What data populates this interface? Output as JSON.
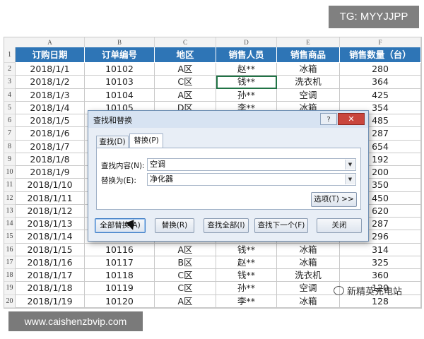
{
  "badges": {
    "tg": "TG: MYYJJPP",
    "url": "www.caishenzbvip.com",
    "watermark": "新精英充电站"
  },
  "spreadsheet": {
    "column_letters": [
      "A",
      "B",
      "C",
      "D",
      "E",
      "F"
    ],
    "headers": [
      "订购日期",
      "订单编号",
      "地区",
      "销售人员",
      "销售商品",
      "销售数量（台）"
    ],
    "row_numbers": [
      "1",
      "2",
      "3",
      "4",
      "5",
      "6",
      "7",
      "8",
      "9",
      "10",
      "11",
      "12",
      "13",
      "14",
      "15",
      "16",
      "17",
      "18",
      "19",
      "20"
    ],
    "rows": [
      [
        "2018/1/1",
        "10102",
        "A区",
        "赵**",
        "冰箱",
        "280"
      ],
      [
        "2018/1/2",
        "10103",
        "C区",
        "钱**",
        "洗衣机",
        "364"
      ],
      [
        "2018/1/3",
        "10104",
        "A区",
        "孙**",
        "空调",
        "425"
      ],
      [
        "2018/1/4",
        "10105",
        "D区",
        "李**",
        "冰箱",
        "354"
      ],
      [
        "2018/1/5",
        "",
        "",
        "",
        "",
        "485"
      ],
      [
        "2018/1/6",
        "",
        "",
        "",
        "",
        "287"
      ],
      [
        "2018/1/7",
        "",
        "",
        "",
        "",
        "654"
      ],
      [
        "2018/1/8",
        "",
        "",
        "",
        "",
        "192"
      ],
      [
        "2018/1/9",
        "",
        "",
        "",
        "",
        "200"
      ],
      [
        "2018/1/10",
        "",
        "",
        "",
        "",
        "350"
      ],
      [
        "2018/1/11",
        "",
        "",
        "",
        "",
        "450"
      ],
      [
        "2018/1/12",
        "",
        "",
        "",
        "",
        "620"
      ],
      [
        "2018/1/13",
        "",
        "",
        "",
        "",
        "287"
      ],
      [
        "2018/1/14",
        "",
        "",
        "",
        "",
        "296"
      ],
      [
        "2018/1/15",
        "10116",
        "A区",
        "钱**",
        "冰箱",
        "314"
      ],
      [
        "2018/1/16",
        "10117",
        "B区",
        "赵**",
        "冰箱",
        "325"
      ],
      [
        "2018/1/17",
        "10118",
        "C区",
        "钱**",
        "洗衣机",
        "360"
      ],
      [
        "2018/1/18",
        "10119",
        "C区",
        "孙**",
        "空调",
        "120"
      ],
      [
        "2018/1/19",
        "10120",
        "A区",
        "李**",
        "冰箱",
        "128"
      ]
    ]
  },
  "dialog": {
    "title": "查找和替换",
    "help_label": "?",
    "close_label": "✕",
    "tabs": [
      "查找(D)",
      "替换(P)"
    ],
    "find_label": "查找内容(N):",
    "find_value": "空调",
    "replace_label": "替换为(E):",
    "replace_value": "净化器",
    "options_button": "选项(T) >>",
    "buttons": [
      "全部替换(A)",
      "替换(R)",
      "查找全部(I)",
      "查找下一个(F)",
      "关闭"
    ]
  },
  "colors": {
    "header_fill": "#2e75b6",
    "dialog_bg": "#e8eef6",
    "close_red": "#c9463d"
  }
}
